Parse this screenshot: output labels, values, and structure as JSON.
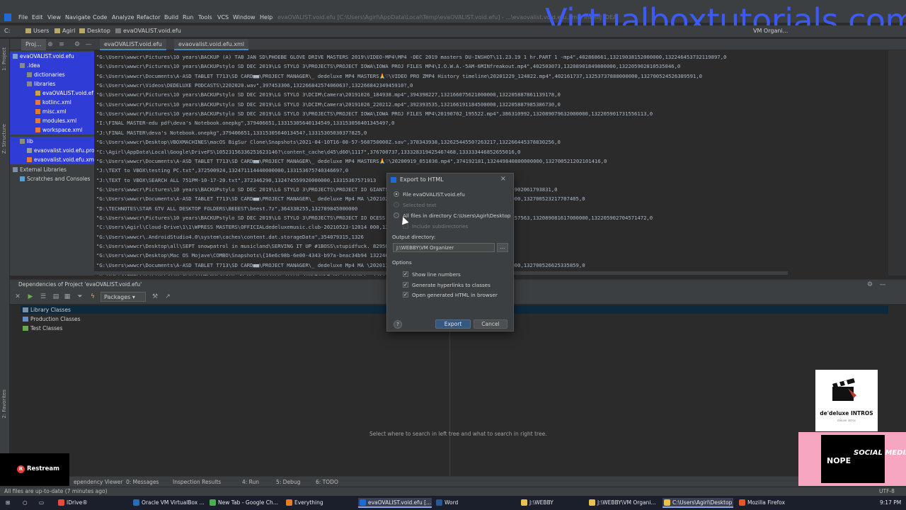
{
  "top_title": "evaOVALIST.void.efu [C:\\Users\\Agirl\\AppData\\Local\\Temp\\evaOVALIST.void.efu] - ...\\evaovalist.void.efu.xml - IntelliJ IDEA",
  "watermark": "Virtualboxtutorials.com",
  "menu": [
    "File",
    "Edit",
    "View",
    "Navigate",
    "Code",
    "Analyze",
    "Refactor",
    "Build",
    "Run",
    "Tools",
    "VCS",
    "Window",
    "Help"
  ],
  "breadcrumbs": [
    "C:",
    "Users",
    "Agirl",
    "Desktop",
    "evaOVALIST.void.efu"
  ],
  "nav_right": "VM Organi...",
  "project_tab": "Proj...",
  "editor_tabs": [
    "evaOVALIST.void.efu",
    "evaovalist.void.efu.xml"
  ],
  "left_strip": [
    "1: Project",
    "Z: Structure",
    "2: Favorites"
  ],
  "tree": [
    {
      "label": "evaOVALIST.void.efu",
      "sel": true
    },
    {
      "label": ".idea",
      "sel": true
    },
    {
      "label": "dictionaries",
      "sel": true
    },
    {
      "label": "libraries",
      "sel": true
    },
    {
      "label": "evaOVALIST.void.ef",
      "sel": true
    },
    {
      "label": "kotlinc.xml",
      "sel": true
    },
    {
      "label": "misc.xml",
      "sel": true
    },
    {
      "label": "modules.xml",
      "sel": true
    },
    {
      "label": "workspace.xml",
      "sel": true
    },
    {
      "label": "lib",
      "sel": true
    },
    {
      "label": "evaovalist.void.efu.proj",
      "sel": true
    },
    {
      "label": "evaovalist.void.efu.xml",
      "sel": true
    },
    {
      "label": "External Libraries",
      "sel": false
    },
    {
      "label": "Scratches and Consoles",
      "sel": false
    }
  ],
  "code_lines": [
    "\"G:\\Users\\wwwcr\\Pictures\\10 years\\BACKUP (A) TAB JAN SD\\PHOEBE GLOVE DRIVE MASTERS 2019\\VIDEO-MP4\\MP4 -DEC 2019 masters DU-INSHOT\\11.23.19 1 hr.PART 1 -mp4\",402868661,13219038152000000,132246453732119897,0",
    "\"G:\\Users\\wwwcr\\Pictures\\10 years\\BACKUPstylo SD DEC 2019\\LG STYLO 3\\PROJECTS\\PROJECT IOWA\\IOWA PROJ FILES MP4\\I.O.W.A.-5AM-6MINfreakout.mp4\",402503073,13208901849800000,132205902810535046,0",
    "\"G:\\Users\\wwwcr\\Documents\\A-ASD TABLET T713\\SD CARD■■\\PROJECT MANAGER\\_ dedeluxe MP4 MASTERS🙏♡\\VIDEO PRO ZMP4 History timeline\\20201229_124822.mp4\",402161737,13253737888000000,132700524526389591,0",
    "\"G:\\Users\\wwwcr\\Videos\\DEDELUXE PODCASTS\\2202020.wav\",397453306,13226684257406063?,13226684234945910?,0",
    "\"G:\\Users\\wwwcr\\Pictures\\10 years\\BACKUPstylo SD DEC 2019\\LG STYLO 3\\DCIM\\Camera\\20191026_184938.mp4\",394398227,132166075621000000,132205887861139178,0",
    "\"G:\\Users\\wwwcr\\Pictures\\10 years\\BACKUPstylo SD DEC 2019\\LG STYLO 3\\DCIM\\Camera\\20191026_220212.mp4\",392393535,132166191184500000,132205887985386730,0",
    "\"G:\\Users\\wwwcr\\Pictures\\10 years\\BACKUPstylo SD DEC 2019\\LG STYLO 3\\PROJECTS\\PROJECT IOWA\\IOWA PROJ FILES MP4\\20190702_195522.mp4\",386310992,132089079632000000,132205901731556113,0",
    "\"I:\\FINAL MASTER-edu pdf\\deva's Notebook.onepkg\",379406651,13315305640134549,13315305640134549?,0",
    "\"J:\\FINAL MASTER\\deva's Notebook.onepkg\",379406651,1331530564013454?,1331530503037?825,0",
    "\"G:\\Users\\wwwcr\\Desktop\\VBOXMACHINES\\macOS BigSur Clone\\Snapshots\\2021-04-10T16-08-57-560750000Z.sav\",378343938,13262544550?263217,132266445378830256,0",
    "\"C:\\Agirl\\AppData\\Local\\Google\\DriveFS\\10523156336251623146?\\content_cache\\d45\\d60\\1117\",376700737,13332831942546?468,133333446852655016,0",
    "\"G:\\Users\\wwwcr\\Documents\\A-ASD TABLET T713\\SD CARD■■\\PROJECT MANAGER\\_ dedeluxe MP4 MASTERS🙏♡\\20200919_051036.mp4\",374192181,132449840800000000,132700521202101416,0",
    "\"J:\\TEXT to VBOX\\testing PC.txt\",372500924,132471114440000000,13315367574034669?,0",
    "\"J:\\TEXT to VBOX\\SEARCH ALL 751PM-10-17-20.txt\",372346290,132474559920000000,13315367571913",
    "\"G:\\Users\\wwwcr\\Pictures\\10 years\\BACKUPstylo SD DEC 2019\\LG STYLO 3\\PROJECTS\\PROJECT IO                                            GIANTS.mp4\",369836706,132089080294800000,132205902061793831,0",
    "\"G:\\Users\\wwwcr\\Documents\\A-ASD TABLET T713\\SD CARD■■\\PROJECT MANAGER\\_ dedeluxe Mp4 MA                                      \\20210214_120007.mp4\",365468291,132577957780000000,132700523217707405,0",
    "\"D:\\TECHNOTES\\STAR GTV ALL DESKTOP FOLDERS\\BEEEST\\beest.7z\",364338255,132789845000000",
    "\"G:\\Users\\wwwcr\\Pictures\\10 years\\BACKUPstylo SD DEC 2019\\LG STYLO 3\\PROJECTS\\PROJECT IO                                            OCESS OF EP OO2. 8;3333AM - COMPLETED.mp4\",362257563,132089081617000000,132205902704571472,0",
    "\"C:\\Users\\Agirl\\Cloud-Drive\\1\\1\\WPRESS MASTERS\\OFFICIALdedeluxemusic.club-20210523-12014                                            000,13333425319557?647,0",
    "\"G:\\Users\\wwwcr\\.AndroidStudio4.0\\system\\caches\\content.dat.storageData\",354079315,1326",
    "\"G:\\Users\\wwwcr\\Desktop\\all\\SEPT snowpatrol in musicland\\SERVING IT UP #1BOSS\\stupidfuck.                                          82950?9608?87,0",
    "\"G:\\Users\\wwwcr\\Desktop\\Mac OS Mojave\\COMBO\\Snapshots\\{16e6c98b-6e00-4343-b97a-beac34b94                                          132246?11997616516,0",
    "\"G:\\Users\\wwwcr\\Documents\\A-ASD TABLET T713\\SD CARD■■\\PROJECT MANAGER\\_ dedeluxe Mp4 MA                                      \\20201128_225923.mp4\",343514533,132510961240000000,132700526625335859,0",
    "\"G:\\Users\\wwwcr\\Pictures\\10 years\\BACKUPstylo SD DEC 2019\\LG STYLO 3\\MP4\\MP4-DU recorder                                        ,132198530?67100000,132205897917991932,0"
  ],
  "deps_title": "Dependencies of Project 'evaOVALIST.void.efu'",
  "deps_select": "Packages",
  "deps_rows": [
    "Library Classes",
    "Production Classes",
    "Test Classes"
  ],
  "deps_hint": "Select where to search in left tree and what to search in right tree.",
  "dialog": {
    "title": "Export to HTML",
    "opt_file": "File evaOVALIST.void.efu",
    "opt_selected": "Selected text",
    "opt_all": "All files in directory C:\\Users\\Agirl\\Desktop",
    "opt_sub": "Include subdirectories",
    "output_label": "Output directory:",
    "output_value": "J:\\WEBBY\\VM Organizer",
    "browse_label": "...",
    "options_label": "Options",
    "chk_line": "Show line numbers",
    "chk_links": "Generate hyperlinks to classes",
    "chk_open": "Open generated HTML in browser",
    "help_label": "?",
    "export_label": "Export",
    "cancel_label": "Cancel"
  },
  "bottom_tabs": [
    "ependency Viewer",
    "0: Messages",
    "Inspection Results",
    "4: Run",
    "5: Debug",
    "6: TODO"
  ],
  "status_left": "All files are up-to-date (7 minutes ago)",
  "status_right": "UTF-8",
  "restream": "Restream",
  "intros_title": "de'deluxe INTROS",
  "intros_sub": "deluxe intros",
  "social_nope": "NOPE",
  "social_text": "SOCIAL MEDIA",
  "taskbar": [
    {
      "label": "IDrive®",
      "color": "#e64a3c"
    },
    {
      "label": "Oracle VM VirtualBox ...",
      "color": "#2f6ab0"
    },
    {
      "label": "New Tab - Google Ch...",
      "color": "#4caf50"
    },
    {
      "label": "Everything",
      "color": "#e67e22"
    },
    {
      "label": "evaOVALIST.void.efu [...",
      "color": "#1e6ad8",
      "active": true
    },
    {
      "label": "Word",
      "color": "#2b5797"
    },
    {
      "label": "J:\\WEBBY",
      "color": "#e6c34a"
    },
    {
      "label": "J:\\WEBBY\\VM Organi...",
      "color": "#e6c34a"
    },
    {
      "label": "C:\\Users\\Agirl\\Desktop",
      "color": "#e6c34a",
      "active": true
    },
    {
      "label": "Mozilla Firefox",
      "color": "#e5582a"
    }
  ],
  "clock": "9:17 PM"
}
